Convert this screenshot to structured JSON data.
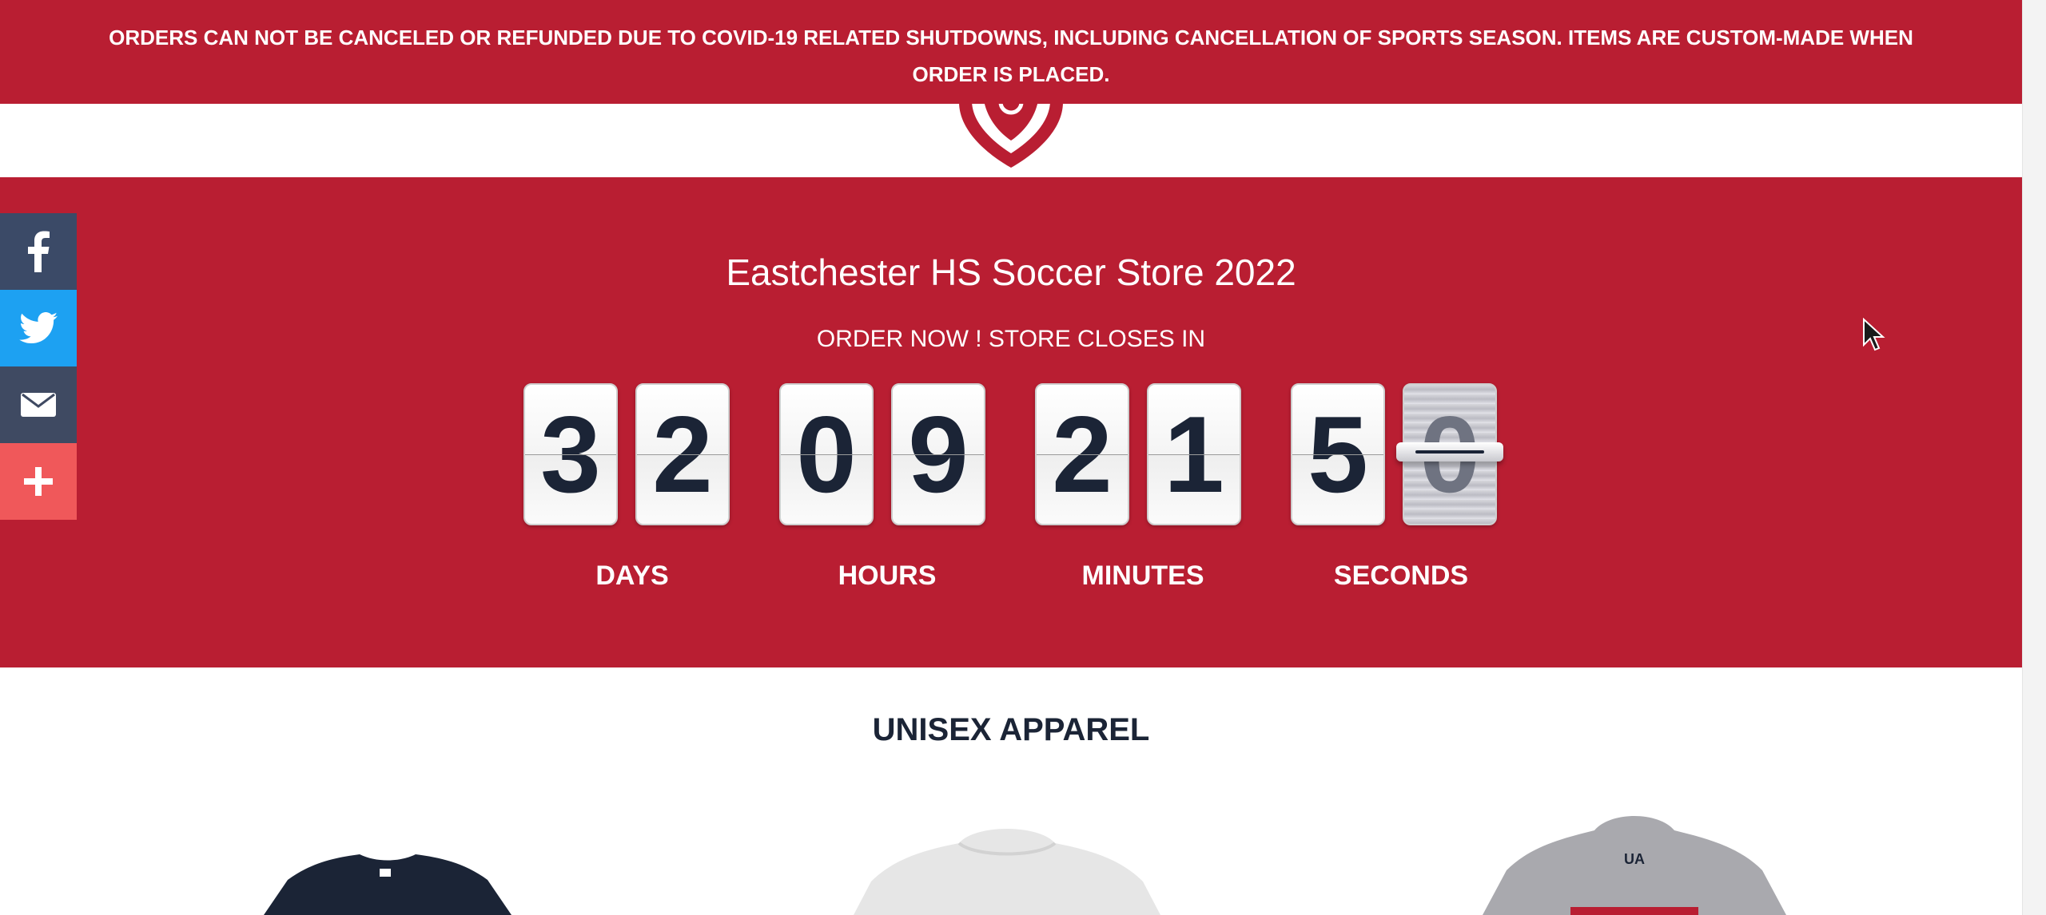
{
  "notice": {
    "text": "ORDERS CAN NOT BE CANCELED OR REFUNDED DUE TO COVID-19 RELATED SHUTDOWNS, INCLUDING CANCELLATION OF SPORTS SEASON. ITEMS ARE CUSTOM-MADE WHEN ORDER IS PLACED."
  },
  "hero": {
    "title": "Eastchester HS Soccer Store 2022",
    "subtitle": "ORDER NOW ! STORE CLOSES IN"
  },
  "countdown": {
    "days": [
      "3",
      "2"
    ],
    "hours": [
      "0",
      "9"
    ],
    "minutes": [
      "2",
      "1"
    ],
    "seconds": [
      "5",
      "0"
    ],
    "labels": {
      "days": "DAYS",
      "hours": "HOURS",
      "minutes": "MINUTES",
      "seconds": "SECONDS"
    }
  },
  "social": {
    "icons": [
      "facebook-icon",
      "twitter-icon",
      "email-icon",
      "plus-icon"
    ]
  },
  "section": {
    "title": "UNISEX APPAREL"
  },
  "colors": {
    "brand_red": "#b91e32",
    "navy": "#1b2436",
    "facebook": "#3b4a67",
    "twitter": "#1da1f2",
    "email": "#3f4a62",
    "more": "#f0585a"
  }
}
